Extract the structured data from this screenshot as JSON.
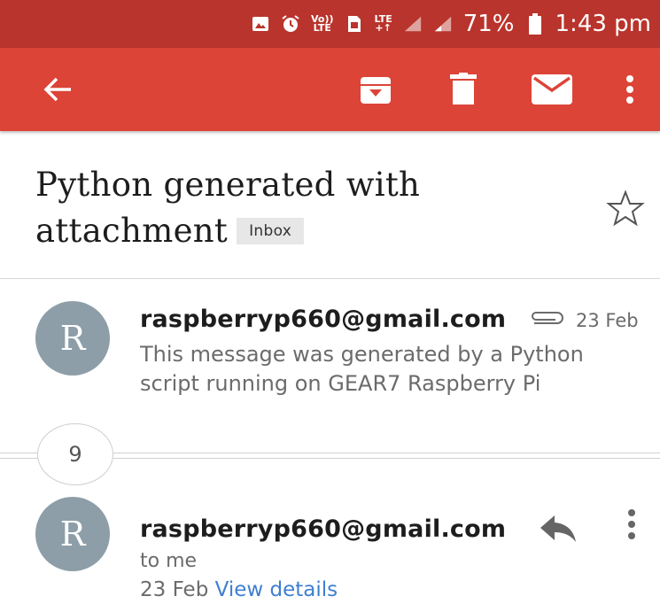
{
  "status_bar": {
    "volte": "Vo))",
    "lte_small": "LTE",
    "lte_plus": "+↑",
    "battery_percent": "71%",
    "time": "1:43 pm"
  },
  "toolbar": {
    "icons": [
      "back-arrow-icon",
      "archive-icon",
      "delete-icon",
      "mark-unread-icon",
      "more-vert-icon"
    ]
  },
  "subject": {
    "title_line1": "Python generated with",
    "title_line2": "attachment",
    "label": "Inbox"
  },
  "messages": [
    {
      "avatar_letter": "R",
      "sender": "raspberryp660@gmail.com",
      "date": "23 Feb",
      "has_attachment": true,
      "snippet": "This message was generated by a Python script running on GEAR7 Raspberry Pi"
    },
    {
      "avatar_letter": "R",
      "sender": "raspberryp660@gmail.com",
      "recipient": "to me",
      "date": "23 Feb",
      "details_link": "View details"
    }
  ],
  "collapsed_count": "9",
  "colors": {
    "status_bar": "#b9342c",
    "toolbar": "#dc4437",
    "avatar": "#8d9ea8",
    "link": "#3f7fd1"
  }
}
